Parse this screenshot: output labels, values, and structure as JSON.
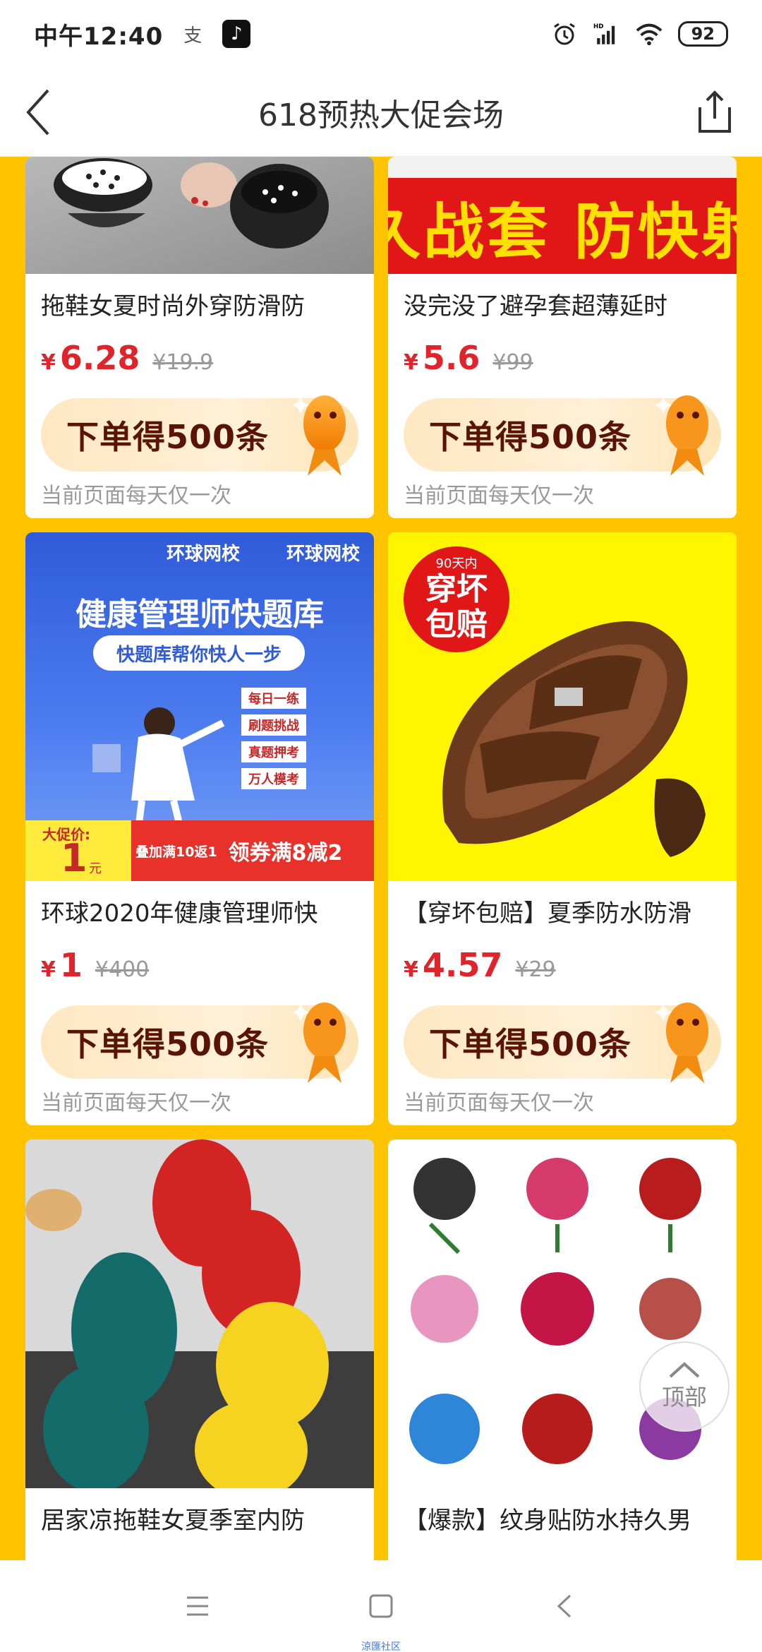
{
  "status_bar": {
    "time": "中午12:40",
    "battery": "92",
    "network_label": "HD"
  },
  "header": {
    "title": "618预热大促会场"
  },
  "products": [
    {
      "title": "拖鞋女夏时尚外穿防滑防",
      "currency": "¥",
      "price": "6.28",
      "original_price": "¥19.9",
      "promo": "下单得500条",
      "limit": "当前页面每天仅一次"
    },
    {
      "title": "没完没了避孕套超薄延时",
      "currency": "¥",
      "price": "5.6",
      "original_price": "¥99",
      "promo": "下单得500条",
      "limit": "当前页面每天仅一次",
      "banner_text": "久战套 防快射"
    },
    {
      "title": "环球2020年健康管理师快",
      "currency": "¥",
      "price": "1",
      "original_price": "¥400",
      "promo": "下单得500条",
      "limit": "当前页面每天仅一次",
      "banner": {
        "brand": "环球网校",
        "headline": "健康管理师快题库",
        "subhead": "快题库帮你快人一步",
        "tags": [
          "每日一练",
          "刷题挑战",
          "真题押考",
          "万人模考"
        ],
        "promo_label": "大促价:",
        "promo_price": "1",
        "promo_unit": "元",
        "stack": "叠加满10返1",
        "coupon": "领券满8减2"
      }
    },
    {
      "title": "【穿坏包赔】夏季防水防滑",
      "currency": "¥",
      "price": "4.57",
      "original_price": "¥29",
      "promo": "下单得500条",
      "limit": "当前页面每天仅一次",
      "badge": {
        "small": "90天内",
        "line1": "穿坏",
        "line2": "包赔"
      }
    },
    {
      "title": "居家凉拖鞋女夏季室内防"
    },
    {
      "title": "【爆款】纹身贴防水持久男"
    }
  ],
  "float_button": {
    "label": "顶部"
  },
  "nav": {
    "menu": "menu-icon",
    "home": "home-icon",
    "back": "back-icon"
  },
  "watermark": "涼匯社区",
  "colors": {
    "page_bg": "#FFC300",
    "price": "#E0242C",
    "promo_text": "#5A1406"
  }
}
